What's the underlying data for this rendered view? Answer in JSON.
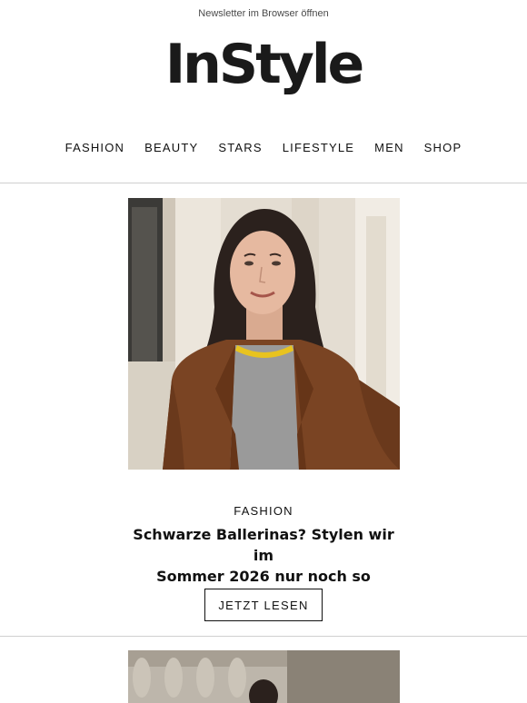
{
  "header": {
    "browser_link": "Newsletter im Browser öffnen",
    "logo": "InStyle"
  },
  "nav": {
    "items": [
      "FASHION",
      "BEAUTY",
      "STARS",
      "LIFESTYLE",
      "MEN",
      "SHOP"
    ]
  },
  "article": {
    "category": "FASHION",
    "headline_line1": "Schwarze Ballerinas? Stylen wir im",
    "headline_line2": "Sommer 2026 nur noch so",
    "cta_label": "JETZT LESEN"
  },
  "colors": {
    "text": "#111111",
    "rule": "#cfcfcf",
    "jacket": "#7a4423",
    "sweater": "#9a9a9a",
    "collar": "#e8c31f"
  }
}
